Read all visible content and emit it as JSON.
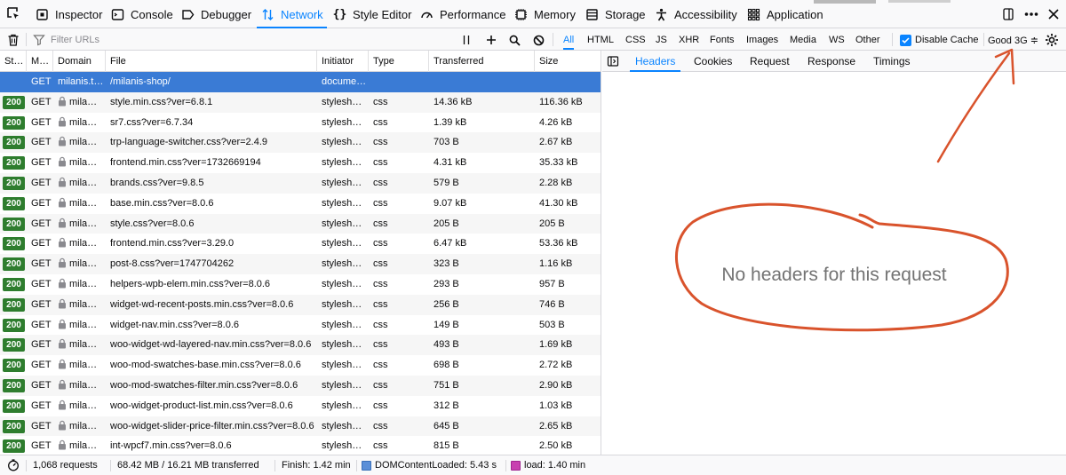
{
  "toolbox": {
    "tabs": [
      {
        "label": "Inspector",
        "icon": "inspector-icon"
      },
      {
        "label": "Console",
        "icon": "console-icon"
      },
      {
        "label": "Debugger",
        "icon": "debugger-icon"
      },
      {
        "label": "Network",
        "icon": "network-icon",
        "selected": true
      },
      {
        "label": "Style Editor",
        "icon": "style-editor-icon"
      },
      {
        "label": "Performance",
        "icon": "performance-icon"
      },
      {
        "label": "Memory",
        "icon": "memory-icon"
      },
      {
        "label": "Storage",
        "icon": "storage-icon"
      },
      {
        "label": "Accessibility",
        "icon": "accessibility-icon"
      },
      {
        "label": "Application",
        "icon": "application-icon"
      }
    ]
  },
  "netmonitor": {
    "filter_placeholder": "Filter URLs",
    "type_filters": [
      "All",
      "HTML",
      "CSS",
      "JS",
      "XHR",
      "Fonts",
      "Images",
      "Media",
      "WS",
      "Other"
    ],
    "active_filter": "All",
    "disable_cache_label": "Disable Cache",
    "disable_cache_checked": true,
    "throttle_label": "Good 3G ≑"
  },
  "table": {
    "columns": [
      "St…",
      "M…",
      "Domain",
      "File",
      "Initiator",
      "Type",
      "Transferred",
      "Size"
    ],
    "rows": [
      {
        "status": "",
        "method": "GET",
        "domain": "milanis.t…",
        "file": "/milanis-shop/",
        "initiator": "docume…",
        "type": "",
        "transferred": "",
        "size": "",
        "selected": true,
        "secure": false
      },
      {
        "status": "200",
        "method": "GET",
        "domain": "mila…",
        "file": "style.min.css?ver=6.8.1",
        "initiator": "stylesh…",
        "type": "css",
        "transferred": "14.36 kB",
        "size": "116.36 kB",
        "secure": true
      },
      {
        "status": "200",
        "method": "GET",
        "domain": "mila…",
        "file": "sr7.css?ver=6.7.34",
        "initiator": "stylesh…",
        "type": "css",
        "transferred": "1.39 kB",
        "size": "4.26 kB",
        "secure": true
      },
      {
        "status": "200",
        "method": "GET",
        "domain": "mila…",
        "file": "trp-language-switcher.css?ver=2.4.9",
        "initiator": "stylesh…",
        "type": "css",
        "transferred": "703 B",
        "size": "2.67 kB",
        "secure": true
      },
      {
        "status": "200",
        "method": "GET",
        "domain": "mila…",
        "file": "frontend.min.css?ver=1732669194",
        "initiator": "stylesh…",
        "type": "css",
        "transferred": "4.31 kB",
        "size": "35.33 kB",
        "secure": true
      },
      {
        "status": "200",
        "method": "GET",
        "domain": "mila…",
        "file": "brands.css?ver=9.8.5",
        "initiator": "stylesh…",
        "type": "css",
        "transferred": "579 B",
        "size": "2.28 kB",
        "secure": true
      },
      {
        "status": "200",
        "method": "GET",
        "domain": "mila…",
        "file": "base.min.css?ver=8.0.6",
        "initiator": "stylesh…",
        "type": "css",
        "transferred": "9.07 kB",
        "size": "41.30 kB",
        "secure": true
      },
      {
        "status": "200",
        "method": "GET",
        "domain": "mila…",
        "file": "style.css?ver=8.0.6",
        "initiator": "stylesh…",
        "type": "css",
        "transferred": "205 B",
        "size": "205 B",
        "secure": true
      },
      {
        "status": "200",
        "method": "GET",
        "domain": "mila…",
        "file": "frontend.min.css?ver=3.29.0",
        "initiator": "stylesh…",
        "type": "css",
        "transferred": "6.47 kB",
        "size": "53.36 kB",
        "secure": true
      },
      {
        "status": "200",
        "method": "GET",
        "domain": "mila…",
        "file": "post-8.css?ver=1747704262",
        "initiator": "stylesh…",
        "type": "css",
        "transferred": "323 B",
        "size": "1.16 kB",
        "secure": true
      },
      {
        "status": "200",
        "method": "GET",
        "domain": "mila…",
        "file": "helpers-wpb-elem.min.css?ver=8.0.6",
        "initiator": "stylesh…",
        "type": "css",
        "transferred": "293 B",
        "size": "957 B",
        "secure": true
      },
      {
        "status": "200",
        "method": "GET",
        "domain": "mila…",
        "file": "widget-wd-recent-posts.min.css?ver=8.0.6",
        "initiator": "stylesh…",
        "type": "css",
        "transferred": "256 B",
        "size": "746 B",
        "secure": true
      },
      {
        "status": "200",
        "method": "GET",
        "domain": "mila…",
        "file": "widget-nav.min.css?ver=8.0.6",
        "initiator": "stylesh…",
        "type": "css",
        "transferred": "149 B",
        "size": "503 B",
        "secure": true
      },
      {
        "status": "200",
        "method": "GET",
        "domain": "mila…",
        "file": "woo-widget-wd-layered-nav.min.css?ver=8.0.6",
        "initiator": "stylesh…",
        "type": "css",
        "transferred": "493 B",
        "size": "1.69 kB",
        "secure": true
      },
      {
        "status": "200",
        "method": "GET",
        "domain": "mila…",
        "file": "woo-mod-swatches-base.min.css?ver=8.0.6",
        "initiator": "stylesh…",
        "type": "css",
        "transferred": "698 B",
        "size": "2.72 kB",
        "secure": true
      },
      {
        "status": "200",
        "method": "GET",
        "domain": "mila…",
        "file": "woo-mod-swatches-filter.min.css?ver=8.0.6",
        "initiator": "stylesh…",
        "type": "css",
        "transferred": "751 B",
        "size": "2.90 kB",
        "secure": true
      },
      {
        "status": "200",
        "method": "GET",
        "domain": "mila…",
        "file": "woo-widget-product-list.min.css?ver=8.0.6",
        "initiator": "stylesh…",
        "type": "css",
        "transferred": "312 B",
        "size": "1.03 kB",
        "secure": true
      },
      {
        "status": "200",
        "method": "GET",
        "domain": "mila…",
        "file": "woo-widget-slider-price-filter.min.css?ver=8.0.6",
        "initiator": "stylesh…",
        "type": "css",
        "transferred": "645 B",
        "size": "2.65 kB",
        "secure": true
      },
      {
        "status": "200",
        "method": "GET",
        "domain": "mila…",
        "file": "int-wpcf7.min.css?ver=8.0.6",
        "initiator": "stylesh…",
        "type": "css",
        "transferred": "815 B",
        "size": "2.50 kB",
        "secure": true
      }
    ]
  },
  "statusbar": {
    "requests": "1,068 requests",
    "transferred": "68.42 MB / 16.21 MB transferred",
    "finish": "Finish: 1.42 min",
    "dom_content_loaded": "DOMContentLoaded: 5.43 s",
    "load": "load: 1.40 min"
  },
  "details": {
    "tabs": [
      "Headers",
      "Cookies",
      "Request",
      "Response",
      "Timings"
    ],
    "selected_tab": "Headers",
    "empty_message": "No headers for this request"
  },
  "colors": {
    "accent": "#0a84ff",
    "selected_row": "#3a7bd5",
    "status_ok": "#2e7d2e",
    "annotation": "#d9532c",
    "dcl_marker": "#5a8fd8",
    "load_marker": "#c83fb0"
  }
}
